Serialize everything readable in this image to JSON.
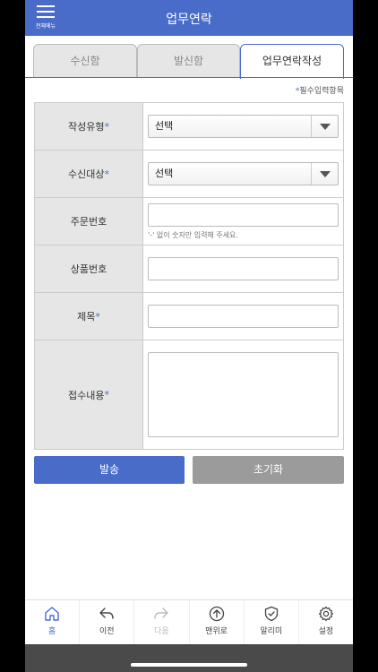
{
  "header": {
    "menu_label": "전체메뉴",
    "title": "업무연락"
  },
  "tabs": [
    {
      "label": "수신함"
    },
    {
      "label": "발신함"
    },
    {
      "label": "업무연락작성"
    }
  ],
  "required_note": "필수입력항목",
  "required_mark": "*",
  "form": {
    "type_label": "작성유형",
    "type_value": "선택",
    "recipient_label": "수신대상",
    "recipient_value": "선택",
    "order_label": "주문번호",
    "order_value": "",
    "order_hint": "'-' 없이 숫자만 입력해 주세요.",
    "product_label": "상품번호",
    "product_value": "",
    "subject_label": "제목",
    "subject_value": "",
    "content_label": "접수내용",
    "content_value": ""
  },
  "buttons": {
    "send": "발송",
    "reset": "초기화"
  },
  "bottom_nav": [
    {
      "label": "홈",
      "icon": "home-icon"
    },
    {
      "label": "이전",
      "icon": "back-icon"
    },
    {
      "label": "다음",
      "icon": "forward-icon"
    },
    {
      "label": "맨위로",
      "icon": "top-icon"
    },
    {
      "label": "알리미",
      "icon": "shield-icon"
    },
    {
      "label": "설정",
      "icon": "gear-icon"
    }
  ],
  "colors": {
    "accent": "#4a6cc9",
    "secondary": "#9b9b9b"
  }
}
